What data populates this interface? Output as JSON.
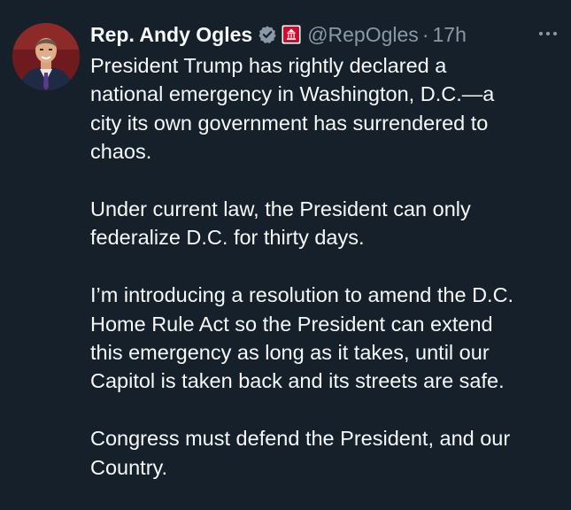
{
  "tweet": {
    "author_name": "Rep. Andy Ogles",
    "handle": "@RepOgles",
    "separator": "·",
    "time_ago": "17h",
    "verified_color": "#8b98a5",
    "badge_color": "#c8102e",
    "paragraphs": [
      "President Trump has rightly declared a\nnational emergency in Washington, D.C.—a\ncity its own government has surrendered to\nchaos.",
      "Under current law, the President can only\nfederalize D.C. for thirty days.",
      "I’m introducing a resolution to amend the D.C.\nHome Rule Act so the President can extend\nthis emergency as long as it takes, until our\nCapitol is taken back and its streets are safe.",
      "Congress must defend the President, and our\nCountry."
    ]
  },
  "icons": {
    "verified": "verified-badge-icon",
    "affiliation": "congress-seal-icon",
    "more": "more-options-icon"
  },
  "colors": {
    "background": "#15202b",
    "text": "#f7f9f9",
    "muted": "#8b98a5"
  }
}
